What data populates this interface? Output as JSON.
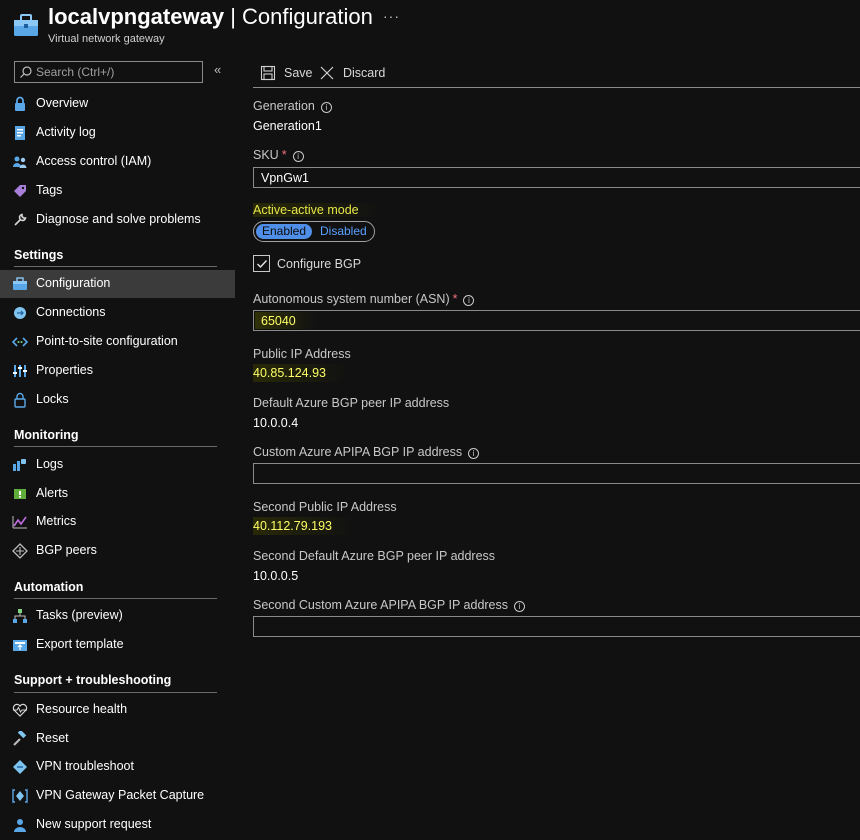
{
  "header": {
    "resource_name": "localvpngateway",
    "separator": " | ",
    "page": "Configuration",
    "more": "···",
    "subtitle": "Virtual network gateway"
  },
  "sidebar": {
    "search_placeholder": "Search (Ctrl+/)",
    "collapse": "«",
    "items_top": [
      {
        "label": "Overview",
        "icon": "lock-shield-icon"
      },
      {
        "label": "Activity log",
        "icon": "activity-log-icon"
      },
      {
        "label": "Access control (IAM)",
        "icon": "people-icon"
      },
      {
        "label": "Tags",
        "icon": "tag-icon"
      },
      {
        "label": "Diagnose and solve problems",
        "icon": "wrench-icon"
      }
    ],
    "sections": {
      "settings": "Settings",
      "monitoring": "Monitoring",
      "automation": "Automation",
      "support": "Support + troubleshooting"
    },
    "settings_items": [
      {
        "label": "Configuration",
        "icon": "toolbox-icon",
        "active": true
      },
      {
        "label": "Connections",
        "icon": "connections-icon"
      },
      {
        "label": "Point-to-site configuration",
        "icon": "code-arrows-icon"
      },
      {
        "label": "Properties",
        "icon": "properties-bars-icon"
      },
      {
        "label": "Locks",
        "icon": "padlock-icon"
      }
    ],
    "monitoring_items": [
      {
        "label": "Logs",
        "icon": "logs-icon"
      },
      {
        "label": "Alerts",
        "icon": "alerts-icon"
      },
      {
        "label": "Metrics",
        "icon": "metrics-icon"
      },
      {
        "label": "BGP peers",
        "icon": "bgp-peers-icon"
      }
    ],
    "automation_items": [
      {
        "label": "Tasks (preview)",
        "icon": "tasks-icon"
      },
      {
        "label": "Export template",
        "icon": "export-template-icon"
      }
    ],
    "support_items": [
      {
        "label": "Resource health",
        "icon": "heart-pulse-icon"
      },
      {
        "label": "Reset",
        "icon": "hammer-icon"
      },
      {
        "label": "VPN troubleshoot",
        "icon": "vpn-troubleshoot-icon"
      },
      {
        "label": "VPN Gateway Packet Capture",
        "icon": "packet-capture-icon"
      },
      {
        "label": "New support request",
        "icon": "support-person-icon"
      }
    ]
  },
  "toolbar": {
    "save_label": "Save",
    "discard_label": "Discard"
  },
  "form": {
    "generation_label": "Generation",
    "generation_value": "Generation1",
    "sku_label": "SKU",
    "required_mark": "*",
    "sku_value": "VpnGw1",
    "active_active_label": "Active-active mode",
    "toggle_enabled": "Enabled",
    "toggle_disabled": "Disabled",
    "toggle_selected": "Enabled",
    "configure_bgp_label": "Configure BGP",
    "configure_bgp_checked": true,
    "asn_label": "Autonomous system number (ASN)",
    "asn_value": "65040",
    "public_ip_label": "Public IP Address",
    "public_ip_value": "40.85.124.93",
    "default_bgp_label": "Default Azure BGP peer IP address",
    "default_bgp_value": "10.0.0.4",
    "custom_apipa_label": "Custom Azure APIPA BGP IP address",
    "custom_apipa_value": "",
    "second_public_ip_label": "Second Public IP Address",
    "second_public_ip_value": "40.112.79.193",
    "second_default_bgp_label": "Second Default Azure BGP peer IP address",
    "second_default_bgp_value": "10.0.0.5",
    "second_custom_apipa_label": "Second Custom Azure APIPA BGP IP address",
    "second_custom_apipa_value": "",
    "info_glyph": "i"
  },
  "colors": {
    "background": "#111111",
    "accent_blue": "#4f8fe8",
    "highlight_yellow": "#ffff66",
    "required_red": "#f1707b",
    "active_row": "#3b3b3b"
  }
}
